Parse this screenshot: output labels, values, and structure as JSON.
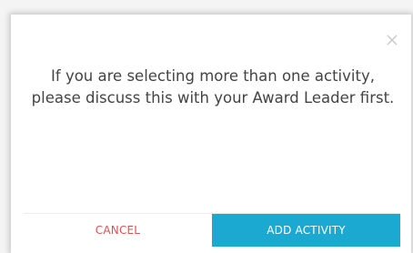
{
  "dialog": {
    "message": "If you are selecting more than one activity, please discuss this with your Award Leader first.",
    "close_icon": "close-icon",
    "cancel_label": "CANCEL",
    "confirm_label": "ADD ACTIVITY"
  },
  "colors": {
    "cancel_text": "#d9534f",
    "primary_button": "#1ba9d2",
    "message_text": "#444444",
    "close_icon": "#c8c8c8"
  }
}
